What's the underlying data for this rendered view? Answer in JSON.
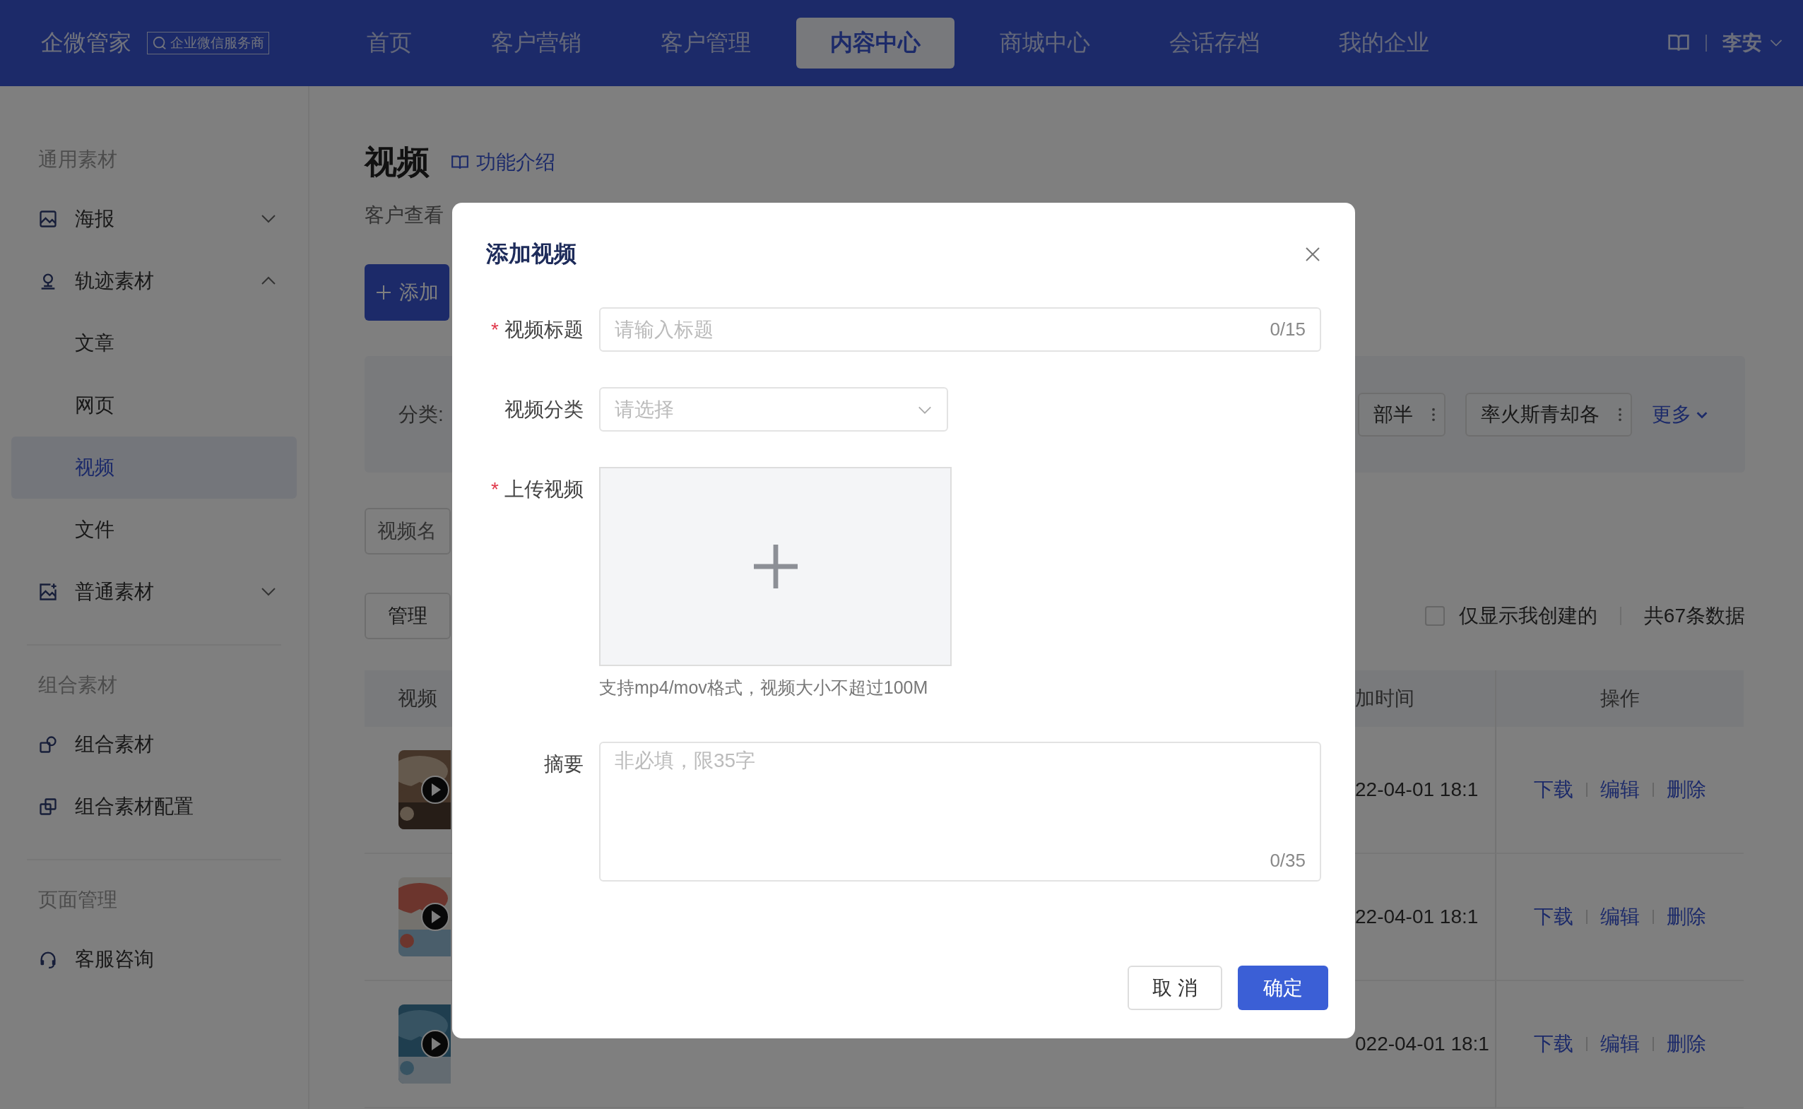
{
  "header": {
    "logo": "企微管家",
    "badge": "企业微信服务商",
    "nav": [
      {
        "label": "首页",
        "selected": false
      },
      {
        "label": "客户营销",
        "selected": false
      },
      {
        "label": "客户管理",
        "selected": false
      },
      {
        "label": "内容中心",
        "selected": true
      },
      {
        "label": "商城中心",
        "selected": false
      },
      {
        "label": "会话存档",
        "selected": false
      },
      {
        "label": "我的企业",
        "selected": false
      }
    ],
    "user": "李安"
  },
  "sidebar": {
    "sections": [
      {
        "title": "通用素材",
        "items": [
          {
            "label": "海报",
            "expanded": false
          },
          {
            "label": "轨迹素材",
            "expanded": true,
            "children": [
              {
                "label": "文章",
                "selected": false
              },
              {
                "label": "网页",
                "selected": false
              },
              {
                "label": "视频",
                "selected": true
              },
              {
                "label": "文件",
                "selected": false
              }
            ]
          },
          {
            "label": "普通素材",
            "expanded": false
          }
        ]
      },
      {
        "title": "组合素材",
        "items": [
          {
            "label": "组合素材"
          },
          {
            "label": "组合素材配置"
          }
        ]
      },
      {
        "title": "页面管理",
        "items": [
          {
            "label": "客服咨询"
          }
        ]
      }
    ]
  },
  "page": {
    "title": "视频",
    "help_link": "功能介绍",
    "description": "客户查看",
    "add_button": "添加",
    "filter": {
      "label": "分类:",
      "tags": [
        "部半",
        "率火斯青却各"
      ],
      "more": "更多"
    },
    "search": {
      "placeholder": "视频名"
    },
    "manage_button": "管理",
    "only_mine": {
      "label": "仅显示我创建的",
      "checked": false
    },
    "total": "共67条数据",
    "table": {
      "columns": [
        "视频",
        "加时间",
        "操作"
      ],
      "rows": [
        {
          "added": "22-04-01 18:1",
          "actions": [
            "下载",
            "编辑",
            "删除"
          ]
        },
        {
          "added": "22-04-01 18:1",
          "actions": [
            "下载",
            "编辑",
            "删除"
          ]
        },
        {
          "added": "022-04-01 18:1",
          "actions": [
            "下载",
            "编辑",
            "删除"
          ]
        }
      ]
    }
  },
  "dialog": {
    "title": "添加视频",
    "fields": [
      {
        "kind": "text",
        "label": "视频标题",
        "required_mark": "*",
        "placeholder": "请输入标题",
        "counter": "0/15"
      },
      {
        "kind": "select",
        "label": "视频分类",
        "placeholder": "请选择"
      },
      {
        "kind": "upload",
        "label": "上传视频",
        "required_mark": "*",
        "hint": "支持mp4/mov格式，视频大小不超过100M"
      },
      {
        "kind": "textarea",
        "label": "摘要",
        "placeholder": "非必填，限35字",
        "counter": "0/35"
      }
    ],
    "buttons": [
      {
        "label": "取 消",
        "primary": false
      },
      {
        "label": "确定",
        "primary": true
      }
    ]
  }
}
